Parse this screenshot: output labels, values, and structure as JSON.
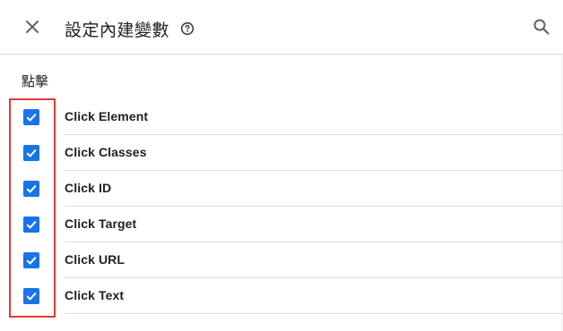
{
  "header": {
    "title": "設定內建變數",
    "close_icon": "close-icon",
    "help_icon": "help-circle-icon",
    "search_icon": "search-icon"
  },
  "section": {
    "title": "點擊"
  },
  "variables": [
    {
      "label": "Click Element",
      "checked": true
    },
    {
      "label": "Click Classes",
      "checked": true
    },
    {
      "label": "Click ID",
      "checked": true
    },
    {
      "label": "Click Target",
      "checked": true
    },
    {
      "label": "Click URL",
      "checked": true
    },
    {
      "label": "Click Text",
      "checked": true
    }
  ],
  "colors": {
    "checkbox_accent": "#1a73e8",
    "highlight_border": "#e53935"
  }
}
